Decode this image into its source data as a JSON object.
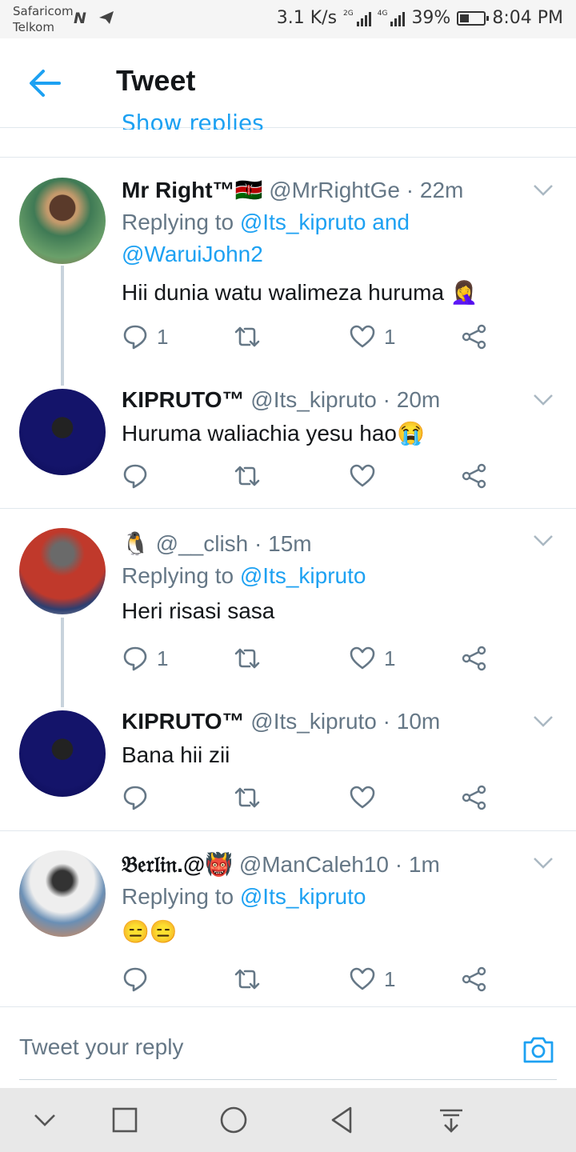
{
  "status_bar": {
    "carrier1": "Safaricom",
    "carrier2": "Telkom",
    "speed": "3.1 K/s",
    "net1": "2G",
    "net2": "4G",
    "battery": "39%",
    "battery_level": 0.39,
    "time": "8:04 PM"
  },
  "header": {
    "title": "Tweet"
  },
  "partial_link": "Show replies",
  "tweets": [
    {
      "name": "Mr Right™🇰🇪",
      "handle": "@MrRightGe",
      "dot": "·",
      "time": "22m",
      "reply_prefix": "Replying to ",
      "reply_to": "@Its_kipruto and @WaruiJohn2",
      "text": "Hii dunia watu walimeza huruma 🤦‍♀️",
      "replies": "1",
      "retweets": "",
      "likes": "1"
    },
    {
      "name": "KIPRUTO™",
      "handle": "@Its_kipruto",
      "dot": "·",
      "time": "20m",
      "text": "Huruma waliachia yesu hao😭",
      "replies": "",
      "retweets": "",
      "likes": ""
    },
    {
      "name": "🐧",
      "handle": "@__clish",
      "dot": "·",
      "time": "15m",
      "reply_prefix": "Replying to ",
      "reply_to": "@Its_kipruto",
      "text": "Heri risasi sasa",
      "replies": "1",
      "retweets": "",
      "likes": "1"
    },
    {
      "name": "KIPRUTO™",
      "handle": "@Its_kipruto",
      "dot": "·",
      "time": "10m",
      "text": "Bana hii zii",
      "replies": "",
      "retweets": "",
      "likes": ""
    },
    {
      "name": "𝔅𝔢𝔯𝔩𝔦𝔫.@👹",
      "handle": "@ManCaleh10",
      "dot": "·",
      "time": "1m",
      "reply_prefix": "Replying to ",
      "reply_to": "@Its_kipruto",
      "text": "😑😑",
      "replies": "",
      "retweets": "",
      "likes": "1"
    }
  ],
  "reply_box": {
    "placeholder": "Tweet your reply"
  },
  "colors": {
    "accent": "#1da1f2",
    "muted": "#657786",
    "border": "#e1e8ed"
  },
  "icons": [
    "back-arrow-icon",
    "reply-icon",
    "retweet-icon",
    "like-icon",
    "share-icon",
    "caret-down-icon",
    "camera-icon"
  ]
}
